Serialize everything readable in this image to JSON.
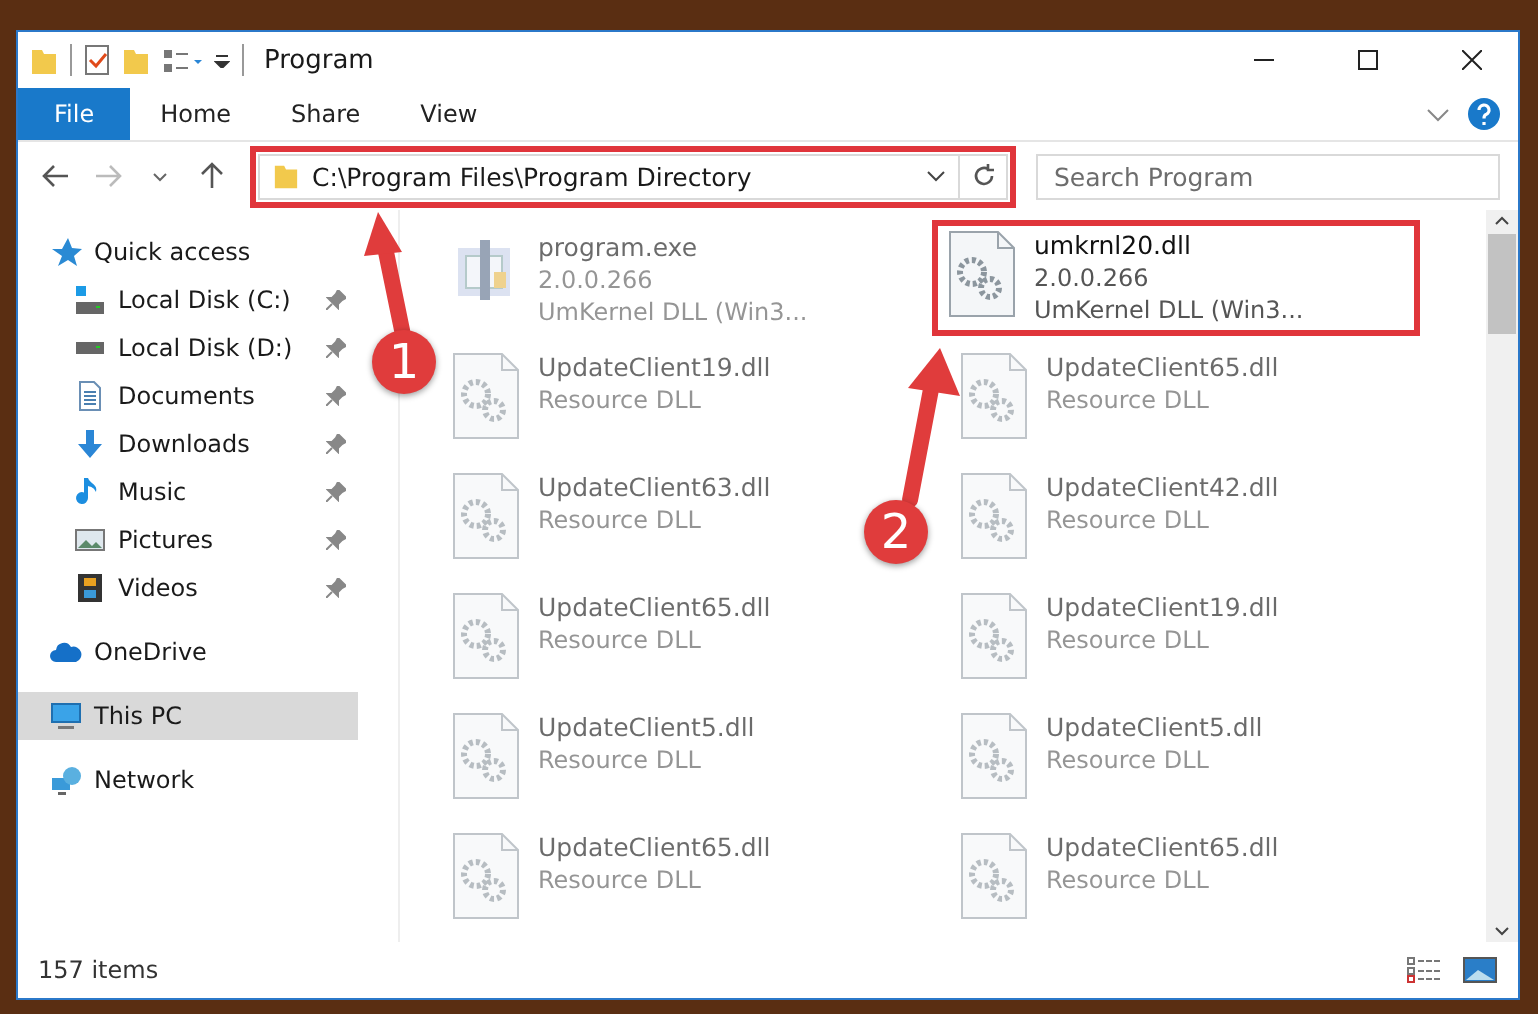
{
  "window": {
    "title": "Program"
  },
  "ribbon_tabs": [
    {
      "label": "File",
      "selected": true
    },
    {
      "label": "Home",
      "selected": false
    },
    {
      "label": "Share",
      "selected": false
    },
    {
      "label": "View",
      "selected": false
    }
  ],
  "address_bar": {
    "value": "C:\\Program Files\\Program Directory",
    "highlighted": true
  },
  "search": {
    "placeholder": "Search Program"
  },
  "sidebar": {
    "items": [
      {
        "label": "Quick access",
        "kind": "star",
        "selected": false,
        "children": [
          {
            "label": "Local Disk (C:)",
            "kind": "drive-win",
            "pinned": true,
            "selected": false
          },
          {
            "label": "Local Disk (D:)",
            "kind": "drive",
            "pinned": true,
            "selected": false
          },
          {
            "label": "Documents",
            "kind": "docs",
            "pinned": true,
            "selected": false
          },
          {
            "label": "Downloads",
            "kind": "download",
            "pinned": true,
            "selected": false
          },
          {
            "label": "Music",
            "kind": "music",
            "pinned": true,
            "selected": false
          },
          {
            "label": "Pictures",
            "kind": "pictures",
            "pinned": true,
            "selected": false
          },
          {
            "label": "Videos",
            "kind": "videos",
            "pinned": true,
            "selected": false
          }
        ]
      },
      {
        "label": "OneDrive",
        "kind": "cloud",
        "selected": false
      },
      {
        "label": "This PC",
        "kind": "pc",
        "selected": true
      },
      {
        "label": "Network",
        "kind": "network",
        "selected": false
      }
    ]
  },
  "files": [
    {
      "kind": "exe",
      "name": "program.exe",
      "version": "2.0.0.266",
      "description": "UmKernel DLL  (Win3...",
      "dimmed": true,
      "highlighted": false
    },
    {
      "kind": "dll",
      "name": "umkrnl20.dll",
      "version": "2.0.0.266",
      "description": "UmKernel DLL  (Win3...",
      "dimmed": false,
      "highlighted": true
    },
    {
      "kind": "dll",
      "name": "UpdateClient19.dll",
      "description": "Resource DLL",
      "dimmed": true,
      "highlighted": false
    },
    {
      "kind": "dll",
      "name": "UpdateClient65.dll",
      "description": "Resource DLL",
      "dimmed": true,
      "highlighted": false
    },
    {
      "kind": "dll",
      "name": "UpdateClient63.dll",
      "description": "Resource DLL",
      "dimmed": true,
      "highlighted": false
    },
    {
      "kind": "dll",
      "name": "UpdateClient42.dll",
      "description": "Resource DLL",
      "dimmed": true,
      "highlighted": false
    },
    {
      "kind": "dll",
      "name": "UpdateClient65.dll",
      "description": "Resource DLL",
      "dimmed": true,
      "highlighted": false
    },
    {
      "kind": "dll",
      "name": "UpdateClient19.dll",
      "description": "Resource DLL",
      "dimmed": true,
      "highlighted": false
    },
    {
      "kind": "dll",
      "name": "UpdateClient5.dll",
      "description": "Resource DLL",
      "dimmed": true,
      "highlighted": false
    },
    {
      "kind": "dll",
      "name": "UpdateClient5.dll",
      "description": "Resource DLL",
      "dimmed": true,
      "highlighted": false
    },
    {
      "kind": "dll",
      "name": "UpdateClient65.dll",
      "description": "Resource DLL",
      "dimmed": true,
      "highlighted": false
    },
    {
      "kind": "dll",
      "name": "UpdateClient65.dll",
      "description": "Resource DLL",
      "dimmed": true,
      "highlighted": false
    }
  ],
  "status_bar": {
    "count": "157 items"
  },
  "callouts": [
    {
      "label": "1"
    },
    {
      "label": "2"
    }
  ]
}
